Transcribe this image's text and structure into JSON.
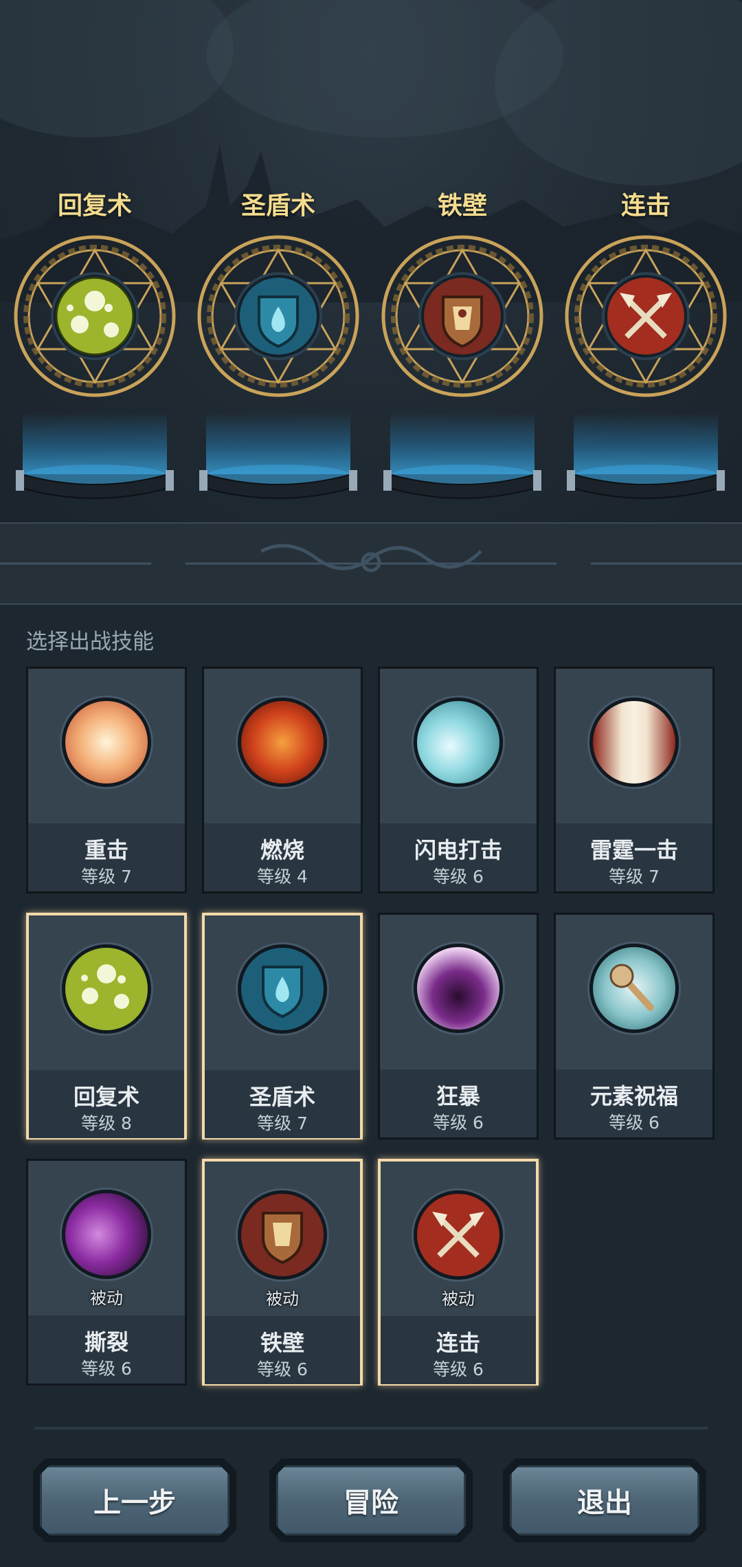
{
  "equipped": [
    {
      "name": "回复术",
      "icon": "healing-bubbles-icon"
    },
    {
      "name": "圣盾术",
      "icon": "water-shield-icon"
    },
    {
      "name": "铁壁",
      "icon": "iron-wall-shield-icon"
    },
    {
      "name": "连击",
      "icon": "crossed-axes-icon"
    }
  ],
  "section_title": "选择出战技能",
  "skills": [
    {
      "name": "重击",
      "level": "等级 7",
      "icon": "smash-burst-icon",
      "selected": false,
      "passive": ""
    },
    {
      "name": "燃烧",
      "level": "等级 4",
      "icon": "fire-swirl-icon",
      "selected": false,
      "passive": ""
    },
    {
      "name": "闪电打击",
      "level": "等级 6",
      "icon": "lightning-orb-icon",
      "selected": false,
      "passive": ""
    },
    {
      "name": "雷霆一击",
      "level": "等级 7",
      "icon": "thunder-strike-icon",
      "selected": false,
      "passive": ""
    },
    {
      "name": "回复术",
      "level": "等级 8",
      "icon": "healing-bubbles-icon",
      "selected": true,
      "passive": ""
    },
    {
      "name": "圣盾术",
      "level": "等级 7",
      "icon": "water-shield-icon",
      "selected": true,
      "passive": ""
    },
    {
      "name": "狂暴",
      "level": "等级 6",
      "icon": "berserk-icon",
      "selected": false,
      "passive": ""
    },
    {
      "name": "元素祝福",
      "level": "等级 6",
      "icon": "element-hammer-icon",
      "selected": false,
      "passive": ""
    },
    {
      "name": "撕裂",
      "level": "等级 6",
      "icon": "tear-claw-icon",
      "selected": false,
      "passive": "被动"
    },
    {
      "name": "铁壁",
      "level": "等级 6",
      "icon": "iron-wall-shield-icon",
      "selected": true,
      "passive": "被动"
    },
    {
      "name": "连击",
      "level": "等级 6",
      "icon": "crossed-axes-icon",
      "selected": true,
      "passive": "被动"
    }
  ],
  "buttons": {
    "back": "上一步",
    "adventure": "冒险",
    "exit": "退出"
  },
  "colors": {
    "accent_gold": "#f4dc8e",
    "selected_border": "#f3d9aa",
    "panel": "#35444f",
    "background": "#1d2730"
  }
}
